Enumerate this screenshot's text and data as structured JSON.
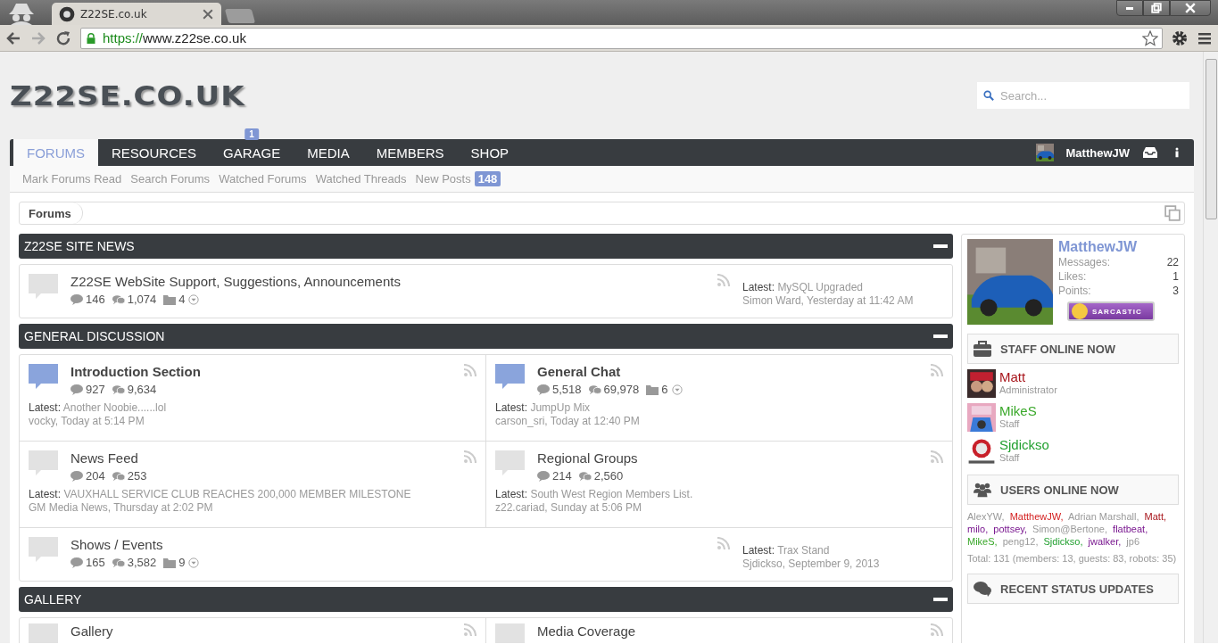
{
  "browser": {
    "tab_title": "Z22SE.co.uk",
    "url": {
      "scheme": "https://",
      "host": "www.z22se.co.uk"
    }
  },
  "header": {
    "logo": "Z22SE.CO.UK",
    "search": {
      "placeholder": "Search..."
    }
  },
  "nav": {
    "tabs": [
      {
        "label": "FORUMS",
        "selected": true
      },
      {
        "label": "RESOURCES",
        "selected": false
      },
      {
        "label": "GARAGE",
        "selected": false,
        "badge": "1"
      },
      {
        "label": "MEDIA",
        "selected": false
      },
      {
        "label": "MEMBERS",
        "selected": false
      },
      {
        "label": "SHOP",
        "selected": false
      }
    ],
    "user": "MatthewJW"
  },
  "subnav": [
    {
      "label": "Mark Forums Read"
    },
    {
      "label": "Search Forums"
    },
    {
      "label": "Watched Forums"
    },
    {
      "label": "Watched Threads"
    },
    {
      "label": "New Posts",
      "badge": "148"
    }
  ],
  "breadcrumb": [
    "Forums"
  ],
  "sections": [
    {
      "title": "Z22SE SITE NEWS",
      "rows": [
        [
          {
            "title": "Z22SE WebSite Support, Suggestions, Announcements",
            "unread": false,
            "discussions": "146",
            "messages": "1,074",
            "subforums": "4",
            "latest": {
              "label": "Latest:",
              "title": "MySQL Upgraded",
              "byline": "Simon Ward, Yesterday at 11:42 AM"
            }
          }
        ]
      ]
    },
    {
      "title": "GENERAL DISCUSSION",
      "rows": [
        [
          {
            "title": "Introduction Section",
            "unread": true,
            "discussions": "927",
            "messages": "9,634",
            "latest": {
              "label": "Latest:",
              "title": "Another Noobie......lol",
              "byline": "vocky, Today at 5:14 PM"
            }
          },
          {
            "title": "General Chat",
            "unread": true,
            "discussions": "5,518",
            "messages": "69,978",
            "subforums": "6",
            "latest": {
              "label": "Latest:",
              "title": "JumpUp Mix",
              "byline": "carson_sri, Today at 12:40 PM"
            }
          }
        ],
        [
          {
            "title": "News Feed",
            "unread": false,
            "discussions": "204",
            "messages": "253",
            "latest": {
              "label": "Latest:",
              "title": "VAUXHALL SERVICE CLUB REACHES 200,000 MEMBER MILESTONE",
              "byline": "GM Media News, Thursday at 2:02 PM"
            }
          },
          {
            "title": "Regional Groups",
            "unread": false,
            "discussions": "214",
            "messages": "2,560",
            "latest": {
              "label": "Latest:",
              "title": "South West Region Members List.",
              "byline": "z22.cariad, Sunday at 5:06 PM"
            }
          }
        ],
        [
          {
            "title": "Shows / Events",
            "unread": false,
            "discussions": "165",
            "messages": "3,582",
            "subforums": "9",
            "latest": {
              "label": "Latest:",
              "title": "Trax Stand",
              "byline": "Sjdickso, September 9, 2013"
            }
          }
        ]
      ]
    },
    {
      "title": "GALLERY",
      "rows": [
        [
          {
            "title": "Gallery",
            "unread": false
          },
          {
            "title": "Media Coverage",
            "unread": false
          }
        ]
      ]
    }
  ],
  "sidebar": {
    "profile": {
      "name": "MatthewJW",
      "stats": [
        {
          "label": "Messages:",
          "value": "22"
        },
        {
          "label": "Likes:",
          "value": "1"
        },
        {
          "label": "Points:",
          "value": "3"
        }
      ],
      "title_badge": "SARCASTIC"
    },
    "staff": {
      "title": "STAFF ONLINE NOW",
      "members": [
        {
          "name": "Matt",
          "role": "Administrator",
          "color": "#a8161c"
        },
        {
          "name": "MikeS",
          "role": "Staff",
          "color": "#3aa82a"
        },
        {
          "name": "Sjdickso",
          "role": "Staff",
          "color": "#22a030"
        }
      ]
    },
    "users_online": {
      "title": "USERS ONLINE NOW",
      "users": [
        {
          "name": "AlexYW,",
          "color": "#9a9a9a"
        },
        {
          "name": "MatthewJW,",
          "color": "#d42020"
        },
        {
          "name": "Adrian Marshall,",
          "color": "#9a9a9a"
        },
        {
          "name": "Matt,",
          "color": "#a8161c"
        },
        {
          "name": "milo,",
          "color": "#7a1890"
        },
        {
          "name": "pottsey,",
          "color": "#7a1890"
        },
        {
          "name": "Simon@Bertone,",
          "color": "#9a9a9a"
        },
        {
          "name": "flatbeat,",
          "color": "#7a1890"
        },
        {
          "name": "MikeS,",
          "color": "#3aa82a"
        },
        {
          "name": "peng12,",
          "color": "#9a9a9a"
        },
        {
          "name": "Sjdickso,",
          "color": "#22a030"
        },
        {
          "name": "jwalker,",
          "color": "#7a1890"
        },
        {
          "name": "jp6",
          "color": "#9a9a9a"
        }
      ],
      "total": "Total: 131 (members: 13, guests: 83, robots: 35)"
    },
    "status_updates": {
      "title": "RECENT STATUS UPDATES"
    }
  }
}
